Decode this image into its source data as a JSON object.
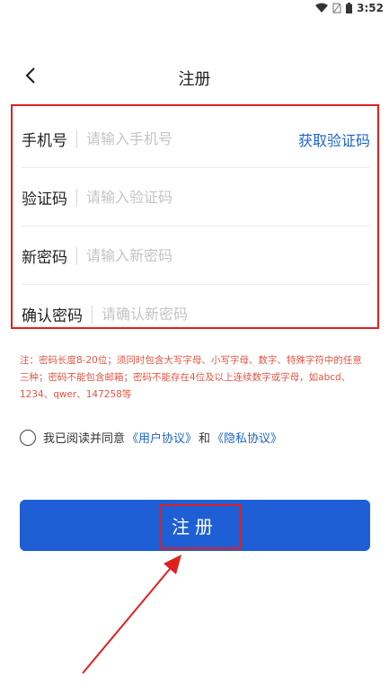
{
  "status_bar": {
    "time": "3:52"
  },
  "header": {
    "title": "注册"
  },
  "form": {
    "phone": {
      "label": "手机号",
      "placeholder": "请输入手机号",
      "value": "",
      "action_label": "获取验证码"
    },
    "code": {
      "label": "验证码",
      "placeholder": "请输入验证码",
      "value": ""
    },
    "new_password": {
      "label": "新密码",
      "placeholder": "请输入新密码",
      "value": ""
    },
    "confirm_password": {
      "label": "确认密码",
      "placeholder": "请确认新密码",
      "value": ""
    }
  },
  "note": "注：密码长度8-20位；须同时包含大写字母、小写字母、数字、特殊字符中的任意三种；密码不能包含邮箱；密码不能存在4位及以上连续数字或字母，如abcd、1234、qwer、147258等",
  "agreement": {
    "prefix": "我已阅读并同意",
    "user_agreement": "《用户协议》",
    "and": "和",
    "privacy_agreement": "《隐私协议》",
    "checked": false
  },
  "submit": {
    "label": "注册"
  },
  "colors": {
    "primary": "#1e5fd6",
    "link": "#1e64c8",
    "highlight": "#e02020",
    "note": "#e05545"
  }
}
